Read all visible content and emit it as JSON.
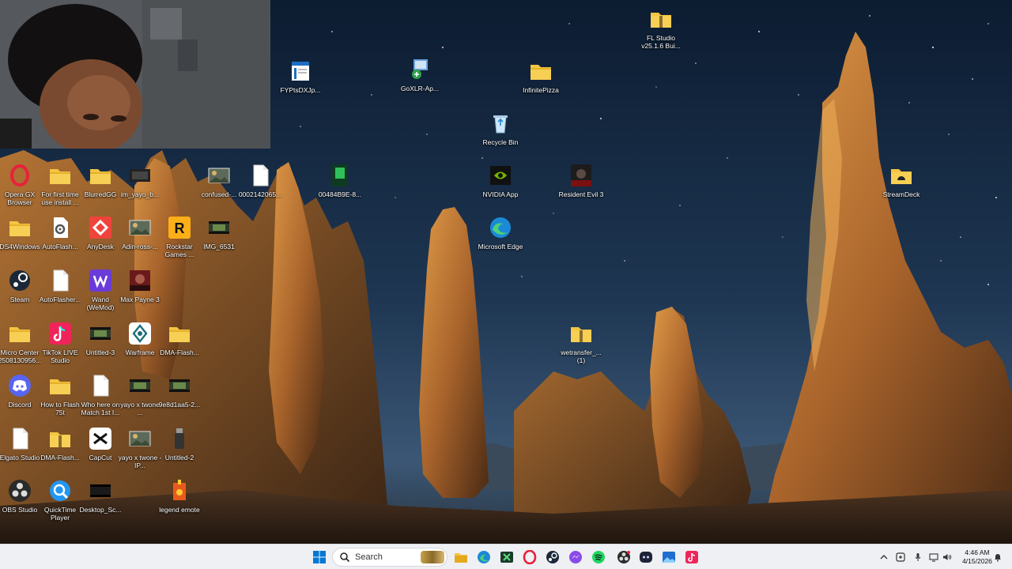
{
  "desktop": {
    "icons": [
      {
        "id": "fl-studio",
        "label": "FL Studio v25.1.6 Bui..."
      },
      {
        "id": "fyptsdx",
        "label": "FYPtsDXJp..."
      },
      {
        "id": "goxlr",
        "label": "GoXLR-Ap..."
      },
      {
        "id": "infinitepizza",
        "label": "InfinitePizza"
      },
      {
        "id": "recycle-bin",
        "label": "Recycle Bin"
      },
      {
        "id": "opera-gx",
        "label": "Opera GX Browser"
      },
      {
        "id": "first-time",
        "label": "For first time use install ..."
      },
      {
        "id": "blurredgg",
        "label": "BlurredGG"
      },
      {
        "id": "im-yayo",
        "label": "im_yayo_b..."
      },
      {
        "id": "confused",
        "label": "confused-..."
      },
      {
        "id": "file-0002142065",
        "label": "0002142065..."
      },
      {
        "id": "file-00484b9e",
        "label": "00484B9E-8..."
      },
      {
        "id": "nvidia-app",
        "label": "NVIDIA App"
      },
      {
        "id": "resident-evil",
        "label": "Resident Evil 3"
      },
      {
        "id": "streamdeck",
        "label": "StreamDeck"
      },
      {
        "id": "ds4windows",
        "label": "DS4Windows"
      },
      {
        "id": "autoflash-1",
        "label": "AutoFlash..."
      },
      {
        "id": "anydesk",
        "label": "AnyDesk"
      },
      {
        "id": "adin-ross",
        "label": "Adin-ross-..."
      },
      {
        "id": "rockstar",
        "label": "Rockstar Games ..."
      },
      {
        "id": "img-6531",
        "label": "IMG_6531"
      },
      {
        "id": "microsoft-edge",
        "label": "Microsoft Edge"
      },
      {
        "id": "steam",
        "label": "Steam"
      },
      {
        "id": "autoflasher",
        "label": "AutoFlasher..."
      },
      {
        "id": "wand",
        "label": "Wand (WeMod)"
      },
      {
        "id": "max-payne",
        "label": "Max Payne 3"
      },
      {
        "id": "micro-center",
        "label": "Micro Center 2508130956..."
      },
      {
        "id": "tiktok-live",
        "label": "TikTok LIVE Studio"
      },
      {
        "id": "untitled-3",
        "label": "Untitled-3"
      },
      {
        "id": "warframe",
        "label": "Warframe"
      },
      {
        "id": "dma-flash-1",
        "label": "DMA-Flash..."
      },
      {
        "id": "wetransfer",
        "label": "wetransfer_... (1)"
      },
      {
        "id": "discord",
        "label": "Discord"
      },
      {
        "id": "how-to-flash",
        "label": "How to Flash 75t"
      },
      {
        "id": "who-here",
        "label": "Who here on Match 1st I..."
      },
      {
        "id": "yayoxtwone-1",
        "label": "yayo x twone ..."
      },
      {
        "id": "file-9e8d1aa5",
        "label": "9e8d1aa5-2..."
      },
      {
        "id": "elgato-studio",
        "label": "Elgato Studio"
      },
      {
        "id": "dma-flash-2",
        "label": "DMA-Flash..."
      },
      {
        "id": "capcut",
        "label": "CapCut"
      },
      {
        "id": "yayoxtwone-2",
        "label": "yayo x twone - IP..."
      },
      {
        "id": "untitled-2",
        "label": "Untitled-2"
      },
      {
        "id": "obs-studio",
        "label": "OBS Studio"
      },
      {
        "id": "quicktime",
        "label": "QuickTime Player"
      },
      {
        "id": "desktop-sc",
        "label": "Desktop_Sc..."
      },
      {
        "id": "legend-emote",
        "label": "legend emote"
      }
    ]
  },
  "taskbar": {
    "search_placeholder": "Search",
    "apps": [
      "start",
      "search",
      "widget-thumbnail",
      "file-explorer",
      "edge",
      "xbox",
      "opera-gx",
      "steam",
      "messenger",
      "spotify",
      "obs-studio",
      "discord",
      "photos",
      "tiktok-live"
    ],
    "clock": {
      "time": "4:46 AM",
      "date": "4/15/2026"
    }
  },
  "colors": {
    "sky_top": "#0d1f36",
    "sky_bottom": "#2f4a66",
    "rock_lit": "#c8843a",
    "taskbar_bg": "#eef0f3",
    "folder": "#f4c542",
    "accent_blue": "#0078d4"
  }
}
